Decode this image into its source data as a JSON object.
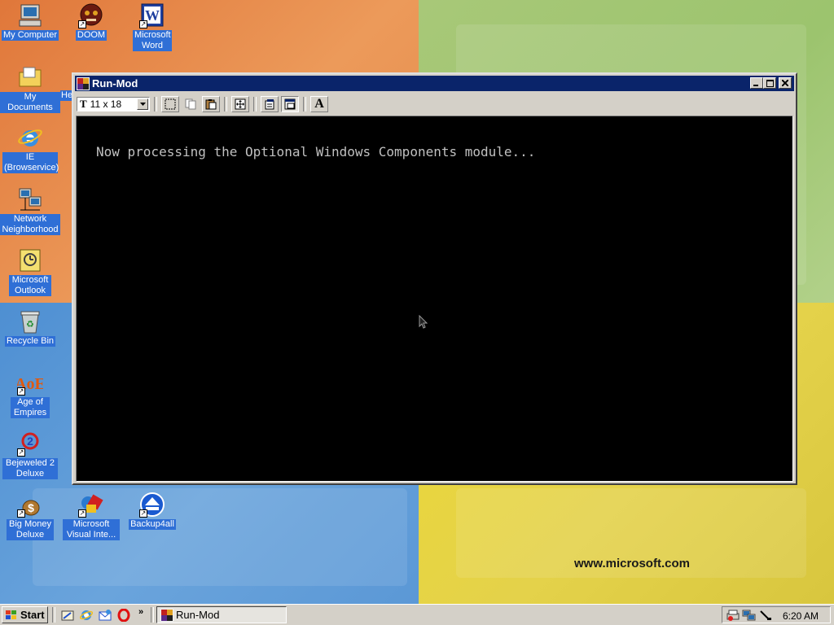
{
  "desktop": {
    "branding_text": "www.microsoft.com",
    "icons": [
      {
        "label": "My Computer",
        "icon": "computer-icon"
      },
      {
        "label": "DOOM",
        "icon": "doom-icon",
        "shortcut": true
      },
      {
        "label": "Microsoft Word",
        "icon": "word-icon",
        "shortcut": true
      },
      {
        "label": "My Documents",
        "icon": "folder-icon"
      },
      {
        "label": "He",
        "icon": "generic-app-icon"
      },
      {
        "label": "IE (Browservice)",
        "icon": "ie-icon"
      },
      {
        "label": "Network Neighborhood",
        "icon": "network-icon"
      },
      {
        "label": "Microsoft Outlook",
        "icon": "outlook-icon"
      },
      {
        "label": "Recycle Bin",
        "icon": "recycle-bin-icon"
      },
      {
        "label": "Age of Empires",
        "icon": "age-of-empires-icon",
        "shortcut": true
      },
      {
        "label": "Bejeweled 2 Deluxe",
        "icon": "bejeweled-icon",
        "shortcut": true
      },
      {
        "label": "Big Money Deluxe",
        "icon": "big-money-icon",
        "shortcut": true
      },
      {
        "label": "Microsoft Visual Inte...",
        "icon": "visual-interdev-icon",
        "shortcut": true
      },
      {
        "label": "Backup4all",
        "icon": "backup4all-icon",
        "shortcut": true
      }
    ]
  },
  "window": {
    "title": "Run-Mod",
    "font_size_select": "11 x 18",
    "console_text": "Now processing the Optional Windows Components module..."
  },
  "taskbar": {
    "start_label": "Start",
    "task_label": "Run-Mod",
    "quick_launch_more": "»",
    "clock": "6:20 AM"
  },
  "colors": {
    "titlebar": "#0a246a",
    "console_bg": "#000000",
    "console_fg": "#c0c0c0",
    "icon_label_bg": "#2f6fd6"
  }
}
